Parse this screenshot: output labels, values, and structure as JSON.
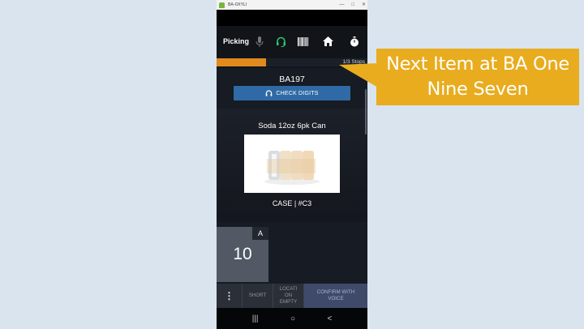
{
  "window": {
    "title": "BA-OXYLI"
  },
  "app": {
    "title": "Picking",
    "icons": [
      "microphone-icon",
      "headset-icon",
      "barcode-icon",
      "home-icon",
      "stopwatch-icon"
    ],
    "progress_fraction": 0.33,
    "stops": "1/3 Stops"
  },
  "pick": {
    "location": "BA197",
    "check_digits_label": "CHECK DIGITS",
    "item_name": "Soda 12oz 6pk Can",
    "uom": "CASE | #C3",
    "quantity": "10",
    "quantity_tag": "A"
  },
  "actions": {
    "menu": "⋮",
    "short": "SHORT",
    "location_empty": "LOCATI\nON\nEMPTY",
    "confirm_voice": "CONFIRM WITH\nVOICE"
  },
  "navbar": {
    "recents": "|||",
    "home": "○",
    "back": "<"
  },
  "callout": {
    "line1": "Next Item at BA One",
    "line2": "Nine Seven"
  },
  "colors": {
    "accent_orange": "#e08a1e",
    "button_blue": "#2f6aa6",
    "callout_yellow": "#e8ac1e",
    "headset_green": "#2ec46a"
  }
}
